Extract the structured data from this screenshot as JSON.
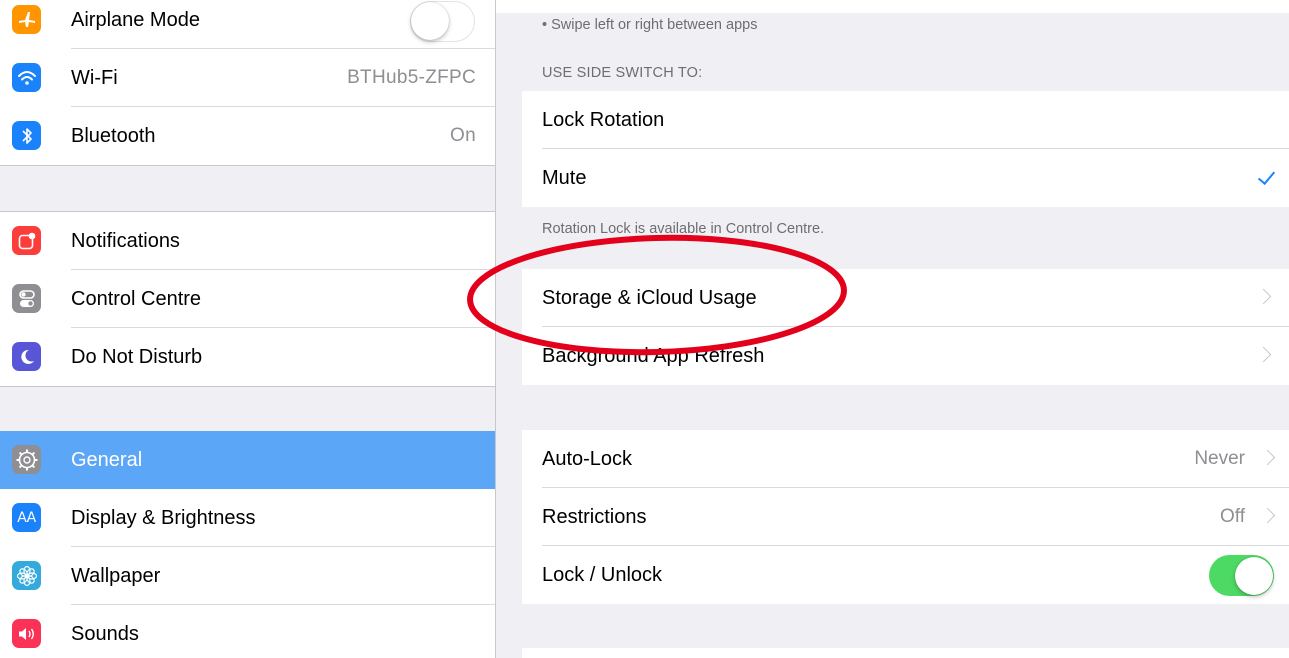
{
  "sidebar": {
    "items": [
      {
        "label": "Airplane Mode",
        "icon": "airplane-icon",
        "color": "#ff9500",
        "toggle": "off"
      },
      {
        "label": "Wi-Fi",
        "icon": "wifi-icon",
        "color": "#1a82fb",
        "value": "BTHub5-ZFPC"
      },
      {
        "label": "Bluetooth",
        "icon": "bluetooth-icon",
        "color": "#1a82fb",
        "value": "On"
      },
      {
        "label": "Notifications",
        "icon": "notifications-icon",
        "color": "#fc3d39"
      },
      {
        "label": "Control Centre",
        "icon": "control-centre-icon",
        "color": "#8e8e93"
      },
      {
        "label": "Do Not Disturb",
        "icon": "moon-icon",
        "color": "#5856d6"
      },
      {
        "label": "General",
        "icon": "gear-icon",
        "color": "#8e8e93",
        "selected": true
      },
      {
        "label": "Display & Brightness",
        "icon": "display-brightness-icon",
        "color": "#1a82fb",
        "glyph": "AA"
      },
      {
        "label": "Wallpaper",
        "icon": "wallpaper-icon",
        "color": "#34aadc"
      },
      {
        "label": "Sounds",
        "icon": "speaker-icon",
        "color": "#fc3158"
      }
    ],
    "selected_color": "#5ba6f6"
  },
  "detail": {
    "top_note": "• Swipe left or right between apps",
    "side_switch_header": "USE SIDE SWITCH TO:",
    "side_switch": {
      "options": [
        "Lock Rotation",
        "Mute"
      ],
      "selected": "Mute",
      "footer": "Rotation Lock is available in Control Centre."
    },
    "group2": {
      "storage": "Storage & iCloud Usage",
      "background_refresh": "Background App Refresh"
    },
    "group3": {
      "auto_lock": {
        "label": "Auto-Lock",
        "value": "Never"
      },
      "restrictions": {
        "label": "Restrictions",
        "value": "Off"
      },
      "lock_unlock": {
        "label": "Lock / Unlock",
        "toggle": "on"
      }
    }
  },
  "colors": {
    "accent": "#1a82fb",
    "toggle_on": "#4cd964",
    "annotation": "#e3001b"
  }
}
